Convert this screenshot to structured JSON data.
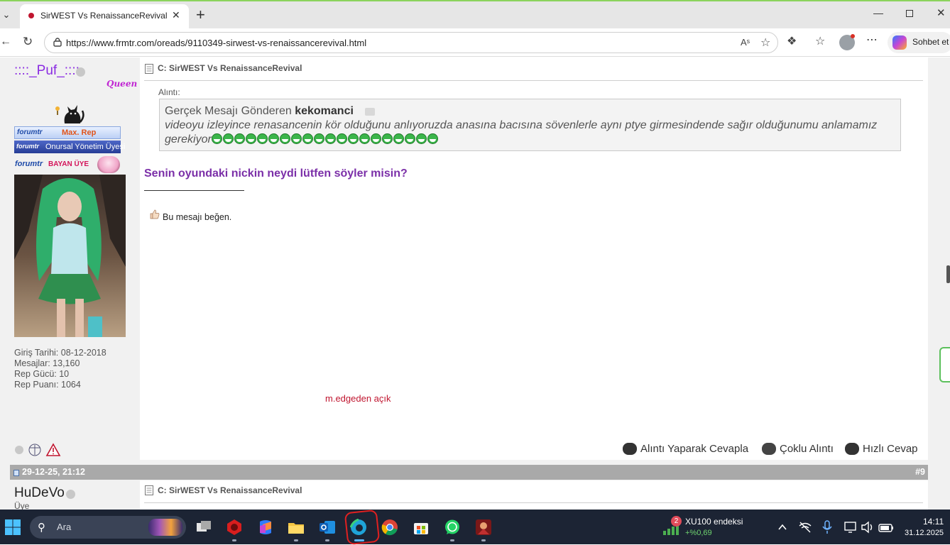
{
  "browser": {
    "tab_title": "SirWEST Vs RenaissanceRevival",
    "url": "https://www.frmtr.com/oreads/9110349-sirwest-vs-renaissancerevival.html",
    "copilot_label": "Sohbet et",
    "read_aloud_label": "Aˢ"
  },
  "post": {
    "user": {
      "name": "::::_Puf_::::",
      "queen_badge": "Queen",
      "badge_rep_brand": "forumtr",
      "badge_rep_text": "Max. Rep",
      "badge_mgmt_brand": "forumtr",
      "badge_mgmt_text": "Onursal Yönetim Üyesi",
      "badge_female_brand": "forumtr",
      "badge_female_text": "BAYAN ÜYE",
      "stats": [
        "Giriş Tarihi: 08-12-2018",
        "Mesajlar: 13,160",
        "Rep Gücü: 10",
        "Rep Puanı: 1064"
      ]
    },
    "title": "C: SirWEST Vs RenaissanceRevival",
    "quote_label": "Alıntı:",
    "quote_prefix": "Gerçek Mesajı Gönderen ",
    "quote_author": "kekomanci",
    "quote_text": "videoyu izleyince renasancenin kör olduğunu anlıyoruzda anasına bacısına sövenlerle aynı ptye girmesindende sağır olduğunumu anlamamız gerekiyor",
    "message": "Senin oyundaki nickin neydi lütfen söyler misin?",
    "like_label": "Bu mesajı beğen.",
    "annotation": "m.edgeden açık",
    "actions": {
      "quote_reply": "Alıntı Yaparak Cevapla",
      "multi_quote": "Çoklu Alıntı",
      "quick_reply": "Hızlı Cevap"
    }
  },
  "next_post": {
    "date": "29-12-25, 21:12",
    "number": "#9",
    "user_name": "HuDeVo",
    "user_rank": "Üye",
    "title": "C: SirWEST Vs RenaissanceRevival"
  },
  "taskbar": {
    "search_placeholder": "Ara",
    "widget_badge": "2",
    "widget_name": "XU100 endeksi",
    "widget_value": "+%0,69",
    "time": "14:11",
    "date": "31.12.2025"
  }
}
